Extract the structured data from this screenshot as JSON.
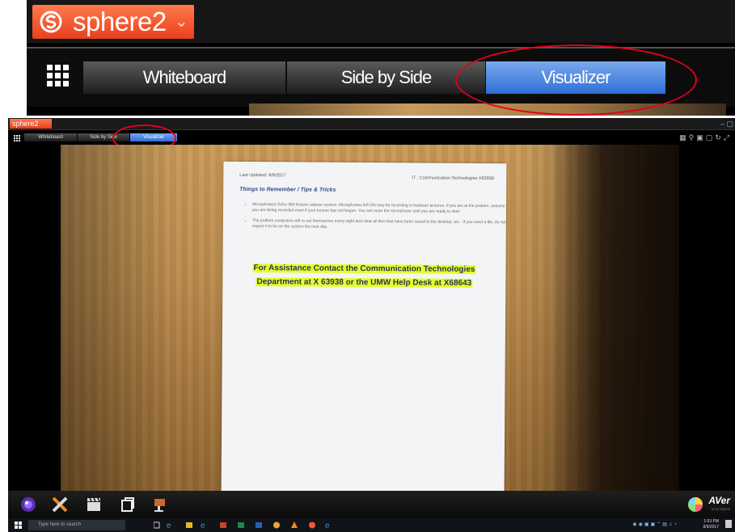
{
  "inset": {
    "app_name": "sphere2",
    "tabs": [
      {
        "label": "Whiteboard",
        "active": false
      },
      {
        "label": "Side by Side",
        "active": false
      },
      {
        "label": "Visualizer",
        "active": true
      }
    ],
    "brand_color": "#ef5a2f",
    "active_tab_color": "#3a7be0",
    "highlight_circle_color": "#e3001b"
  },
  "main": {
    "app_name": "sphere2",
    "window_controls": "– ▢",
    "tabs": [
      {
        "label": "Whiteboard",
        "active": false
      },
      {
        "label": "Side by Side",
        "active": false
      },
      {
        "label": "Visualizer",
        "active": true
      }
    ],
    "right_tools": [
      "grid-tool-icon",
      "zoom-icon",
      "window-icon",
      "fit-icon",
      "rotate-icon",
      "fullscreen-icon"
    ],
    "document": {
      "last_updated": "Last Updated: 8/9/2017",
      "dept_header": "IT , Communication Technologies X63938",
      "heading": "Things to Remember / Tips & Tricks",
      "bullets": [
        "Microphones/ Echo 360 lecture capture system: Microphones left ON may be recording in between lectures. If you are at the podium, assume you are being recorded even if your lecture has not begun. You can mute the microphone until you are ready to start.",
        "The podium computers will re-set themselves every night and clear all files that have been saved to the desktop, etc.. If you need a file, do not expect it to be on the system the next day."
      ],
      "highlight_line1": "For Assistance Contact the Communication Technologies",
      "highlight_line2": "Department at X 63938 or the UMW Help Desk at X68643"
    },
    "toolbar": {
      "icons": [
        "camera-lens-icon",
        "tools-icon",
        "clapperboard-icon",
        "copy-icon",
        "presenter-icon"
      ],
      "brand": "AVer",
      "version": "V2.5.7118.11"
    },
    "taskbar": {
      "search_placeholder": "Type here to search",
      "time": "1:53 PM",
      "date": "8/9/2017"
    }
  }
}
